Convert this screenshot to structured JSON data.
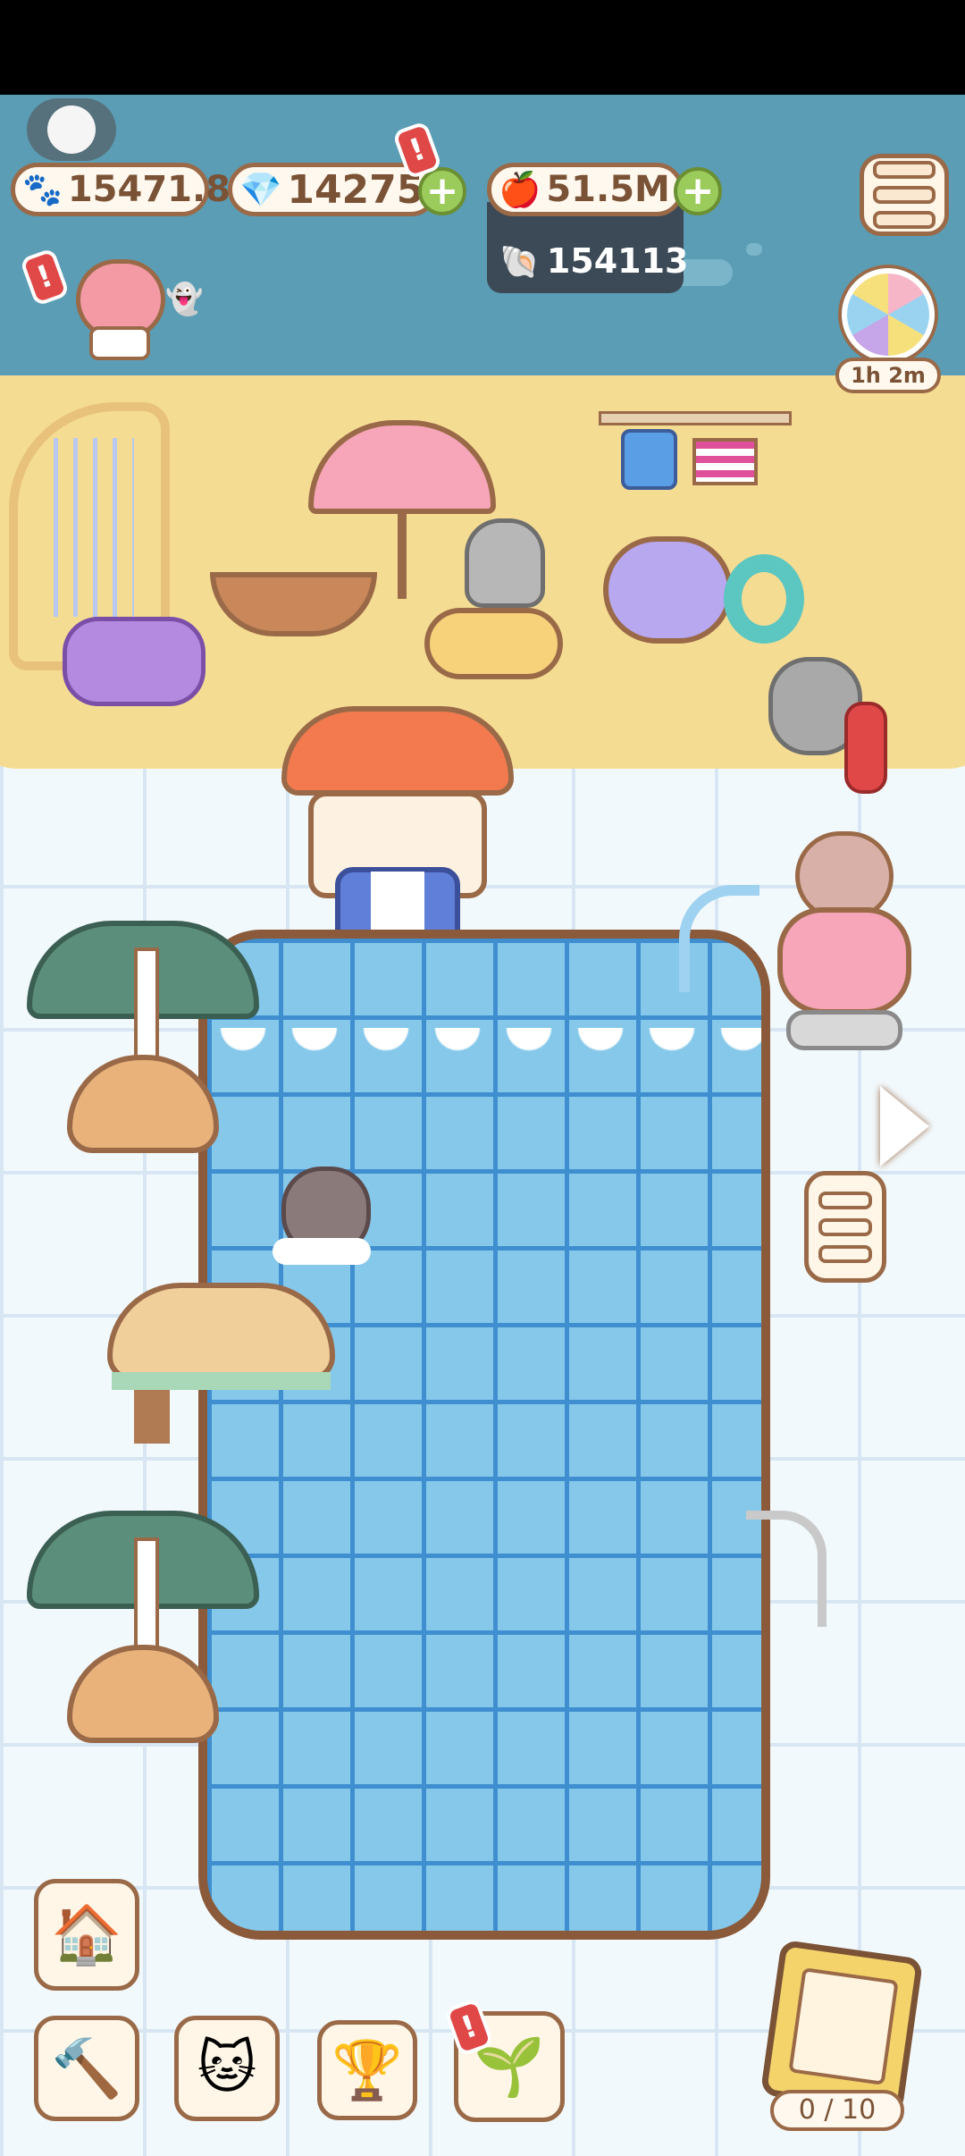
{
  "hud": {
    "paw_currency": "15471.8",
    "gems": "14275",
    "fruit": "51.5M",
    "shells": "154113"
  },
  "timer": {
    "text": "1h 2m"
  },
  "album": {
    "counter": "0 / 10"
  },
  "icons": {
    "paw": "paw-icon",
    "gem": "gem-icon",
    "fruit": "fruit-icon",
    "shell": "shell-icon",
    "menu": "menu-icon",
    "wheel": "spin-wheel-icon",
    "play": "play-arrow-icon",
    "hammer": "hammer-icon",
    "cat": "cat-icon",
    "trophy": "trophy-icon",
    "plant": "plant-icon",
    "house": "house-icon"
  },
  "colors": {
    "sea": "#5b9db5",
    "sand": "#f5dc93",
    "pool": "#86c8ea",
    "outline": "#9a6a48",
    "plus": "#9bcb5a",
    "alert": "#e04848"
  }
}
